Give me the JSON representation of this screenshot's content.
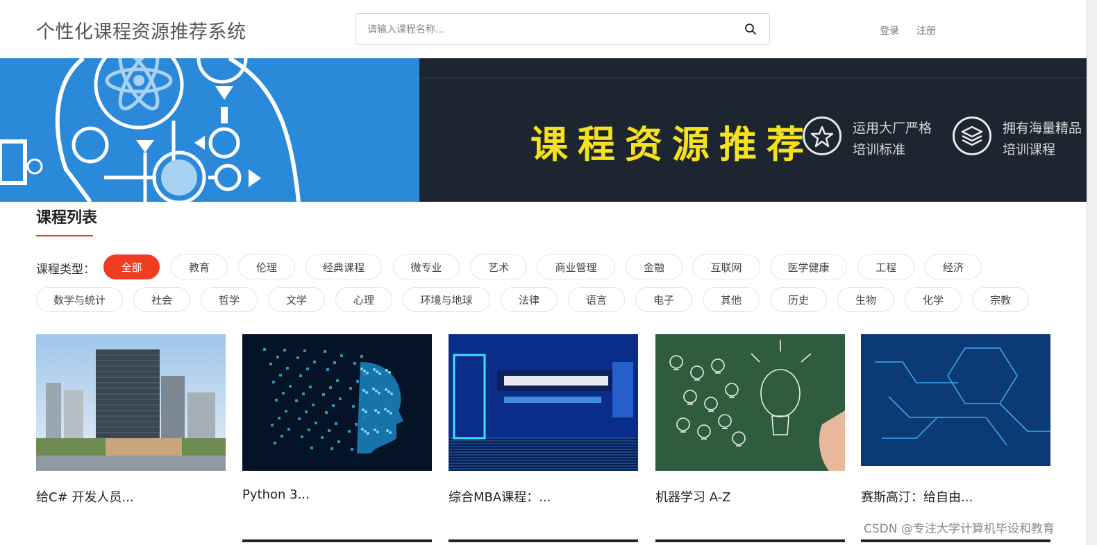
{
  "header": {
    "logo": "个性化课程资源推荐系统",
    "search_placeholder": "请输入课程名称...",
    "login": "登录",
    "register": "注册"
  },
  "banner": {
    "title": "课程资源推荐",
    "features": [
      {
        "line1": "运用大厂严格",
        "line2": "培训标准"
      },
      {
        "line1": "拥有海量精品",
        "line2": "培训课程"
      }
    ],
    "colors": {
      "left": "#2a8ad9",
      "right": "#1d2630",
      "title": "#f5e11e"
    }
  },
  "section": {
    "title": "课程列表",
    "type_label": "课程类型："
  },
  "categories": [
    "全部",
    "教育",
    "伦理",
    "经典课程",
    "微专业",
    "艺术",
    "商业管理",
    "金融",
    "互联网",
    "医学健康",
    "工程",
    "经济",
    "数学与统计",
    "社会",
    "哲学",
    "文学",
    "心理",
    "环境与地球",
    "法律",
    "语言",
    "电子",
    "其他",
    "历史",
    "生物",
    "化学",
    "宗教"
  ],
  "active_category": "全部",
  "courses": [
    {
      "name": "给C# 开发人员...",
      "image": "office-buildings"
    },
    {
      "name": "Python 3...",
      "image": "digital-head"
    },
    {
      "name": "综合MBA课程：...",
      "image": "blue-tech-banner"
    },
    {
      "name": "机器学习 A-Z",
      "image": "chalkboard-lightbulbs"
    },
    {
      "name": "赛斯高汀：给自由...",
      "image": "circuit-network"
    }
  ],
  "watermark": "CSDN @专注大学计算机毕设和教育",
  "accent_color": "#ee3d23"
}
